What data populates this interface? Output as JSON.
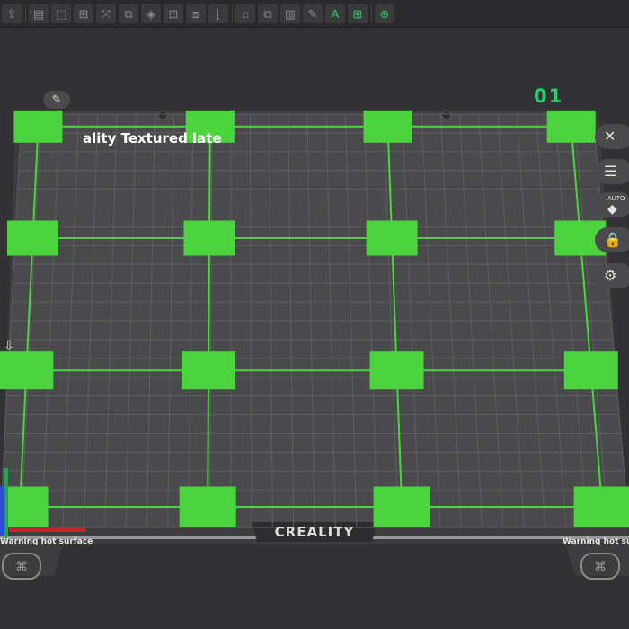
{
  "toolbar": {
    "tools": [
      {
        "name": "import-icon",
        "glyph": "⇪"
      },
      {
        "name": "save-icon",
        "glyph": "▤"
      },
      {
        "name": "add-plate-icon",
        "glyph": "⬚"
      },
      {
        "name": "arrange-icon",
        "glyph": "⊞"
      },
      {
        "name": "orient-icon",
        "glyph": "⤧"
      },
      {
        "name": "layout-icon",
        "glyph": "⧉"
      },
      {
        "name": "support-icon",
        "glyph": "◈"
      },
      {
        "name": "split-icon",
        "glyph": "⊡"
      },
      {
        "name": "boolean-icon",
        "glyph": "⧈"
      },
      {
        "name": "measure-icon",
        "glyph": "⌊"
      },
      {
        "name": "cut-icon",
        "glyph": "⌂"
      },
      {
        "name": "hollow-icon",
        "glyph": "⧉"
      },
      {
        "name": "fill-icon",
        "glyph": "▥"
      },
      {
        "name": "paint-icon",
        "glyph": "✎"
      },
      {
        "name": "text-icon",
        "glyph": "A"
      },
      {
        "name": "assembly-icon",
        "glyph": "⊞"
      },
      {
        "name": "view-icon",
        "glyph": "⊕"
      }
    ]
  },
  "plate": {
    "index": "01",
    "name": "ality Textured     late",
    "brand": "CREALITY",
    "warning_left": "Warning hot surface",
    "warning_right": "Warning hot surface"
  },
  "side_buttons": {
    "close": "✕",
    "list": "☰",
    "auto_label": "AUTO",
    "auto_glyph": "◆",
    "lock": "🔒",
    "settings": "⚙"
  },
  "colors": {
    "background": "#323234",
    "plate": "#4a4a4c",
    "grid": "#5e5e61",
    "pad_green": "#4cd43f",
    "accent": "#22d06c"
  },
  "pads": {
    "rows": 4,
    "cols": 4,
    "count": 16
  }
}
